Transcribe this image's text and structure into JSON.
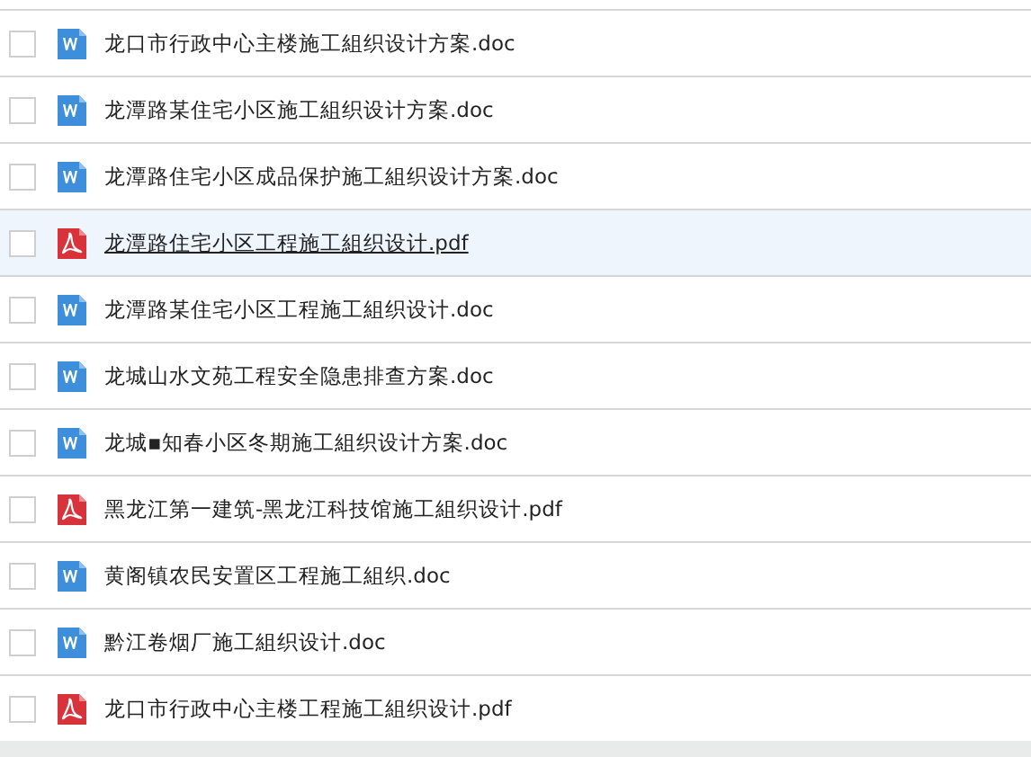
{
  "files": [
    {
      "kind": "doc",
      "name": "龙口市行政中心主楼施工組织设计方案.doc",
      "checked": false,
      "hovered": false
    },
    {
      "kind": "doc",
      "name": "龙潭路某住宅小区施工組织设计方案.doc",
      "checked": false,
      "hovered": false
    },
    {
      "kind": "doc",
      "name": "龙潭路住宅小区成品保护施工組织设计方案.doc",
      "checked": false,
      "hovered": false
    },
    {
      "kind": "pdf",
      "name": "龙潭路住宅小区工程施工組织设计.pdf",
      "checked": false,
      "hovered": true
    },
    {
      "kind": "doc",
      "name": "龙潭路某住宅小区工程施工組织设计.doc",
      "checked": false,
      "hovered": false
    },
    {
      "kind": "doc",
      "name": "龙城山水文苑工程安全隐患排查方案.doc",
      "checked": false,
      "hovered": false
    },
    {
      "kind": "doc",
      "name": "龙城▪知春小区冬期施工組织设计方案.doc",
      "checked": false,
      "hovered": false
    },
    {
      "kind": "pdf",
      "name": "黑龙江第一建筑-黑龙江科技馆施工組织设计.pdf",
      "checked": false,
      "hovered": false
    },
    {
      "kind": "doc",
      "name": "黄阁镇农民安置区工程施工組织.doc",
      "checked": false,
      "hovered": false
    },
    {
      "kind": "doc",
      "name": "黔江卷烟厂施工組织设计.doc",
      "checked": false,
      "hovered": false
    },
    {
      "kind": "pdf",
      "name": "龙口市行政中心主楼工程施工組织设计.pdf",
      "checked": false,
      "hovered": false
    }
  ]
}
